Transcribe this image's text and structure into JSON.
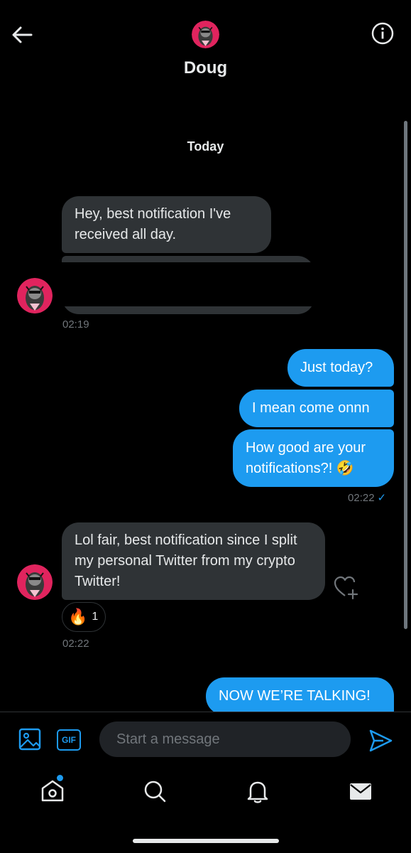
{
  "header": {
    "contact_name": "Doug",
    "back_icon": "arrow-left-icon",
    "info_icon": "info-icon"
  },
  "conversation": {
    "date_separator": "Today",
    "messages": [
      {
        "direction": "incoming",
        "text": "Hey, best notification I've received all day."
      },
      {
        "direction": "incoming",
        "text": ""
      },
      {
        "direction": "outgoing",
        "text": "Just today?"
      },
      {
        "direction": "outgoing",
        "text": "I mean come onnn"
      },
      {
        "direction": "outgoing",
        "text": "How good are your notifications?! 🤣"
      },
      {
        "direction": "incoming",
        "text": "Lol fair, best notification since I split my personal Twitter from my crypto Twitter!"
      },
      {
        "direction": "outgoing",
        "text": "NOW WE’RE TALKING!"
      }
    ],
    "timestamps": {
      "first_group": "02:19",
      "second_group": "02:22",
      "third_group": "02:22"
    },
    "read_check": "✓",
    "reaction": {
      "emoji": "🔥",
      "count": "1"
    }
  },
  "composer": {
    "placeholder": "Start a message",
    "gif_label": "GIF"
  },
  "colors": {
    "accent": "#1d9bf0",
    "incoming_bubble": "#2f3336",
    "background": "#000000",
    "avatar_red": "#e0245e"
  }
}
